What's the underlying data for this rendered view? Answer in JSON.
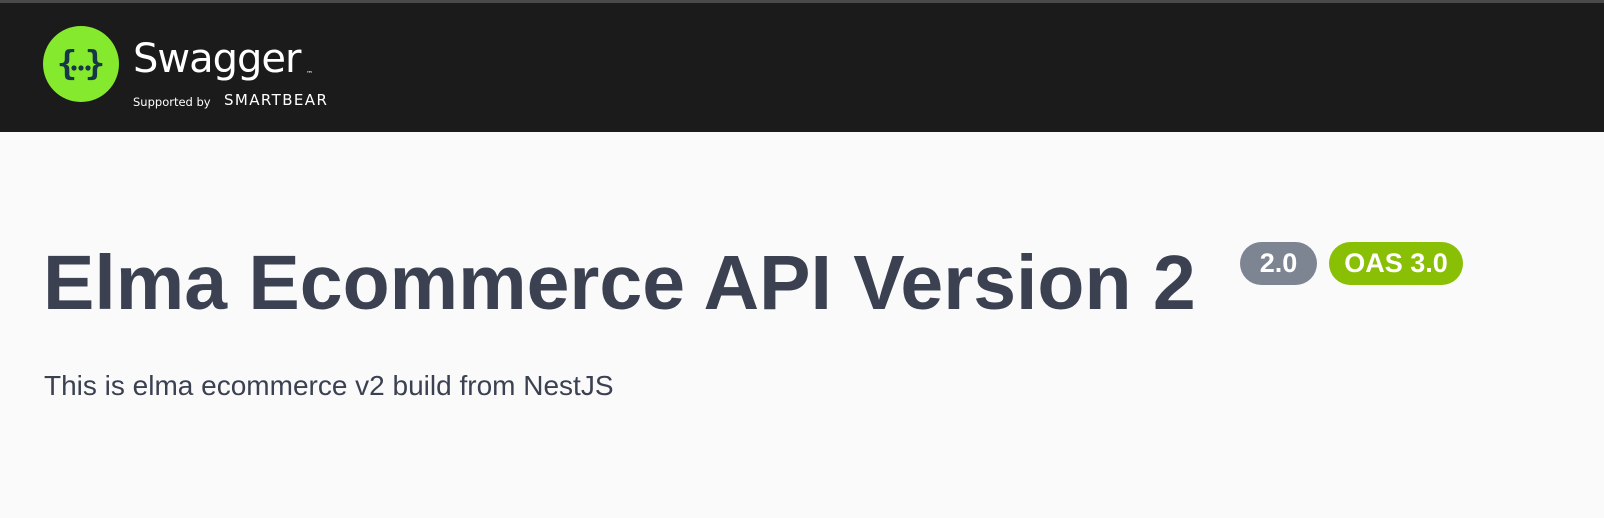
{
  "topbar": {
    "brand_name": "Swagger",
    "trademark": "™",
    "supported_by": "Supported by",
    "company": "SMARTBEAR",
    "logo_color": "#85ea2d",
    "background_color": "#1b1b1b"
  },
  "info": {
    "title": "Elma Ecommerce API Version 2",
    "version_badge": "2.0",
    "oas_badge": "OAS 3.0",
    "description": "This is elma ecommerce v2 build from NestJS",
    "text_color": "#3b4151",
    "version_badge_color": "#7d8492",
    "oas_badge_color": "#89bf04"
  }
}
